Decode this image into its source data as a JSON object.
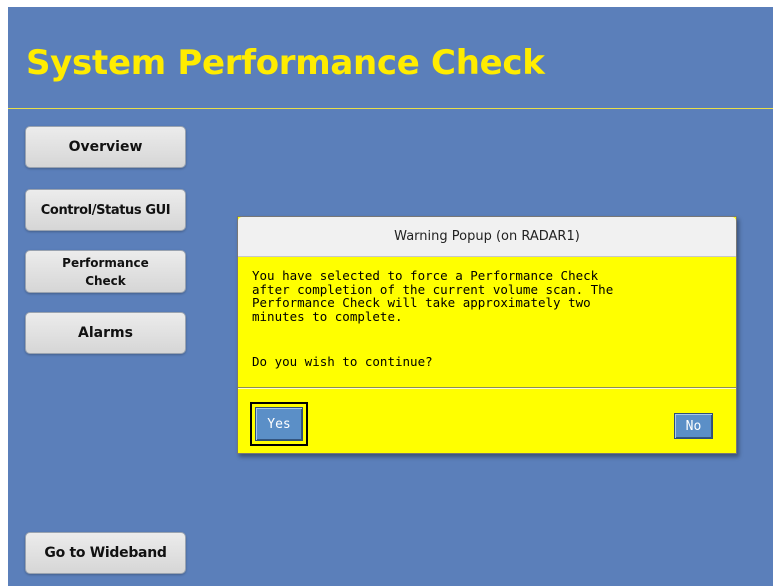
{
  "title": "System Performance Check",
  "nav": {
    "overview": "Overview",
    "control_status": "Control/Status GUI",
    "performance_line1": "Performance",
    "performance_line2": "Check",
    "alarms": "Alarms",
    "go_to_wideband": "Go to Wideband"
  },
  "popup": {
    "title": "Warning Popup (on RADAR1)",
    "message": "You have selected to force a Performance Check\nafter completion of the current volume scan. The\nPerformance Check will take approximately two\nminutes to complete.",
    "question": "Do you wish to continue?",
    "yes_label": "Yes",
    "no_label": "No"
  },
  "colors": {
    "background": "#5b7fba",
    "title": "#ffec00",
    "popup_body": "#ffff00",
    "dialog_button": "#5b8fc7"
  }
}
